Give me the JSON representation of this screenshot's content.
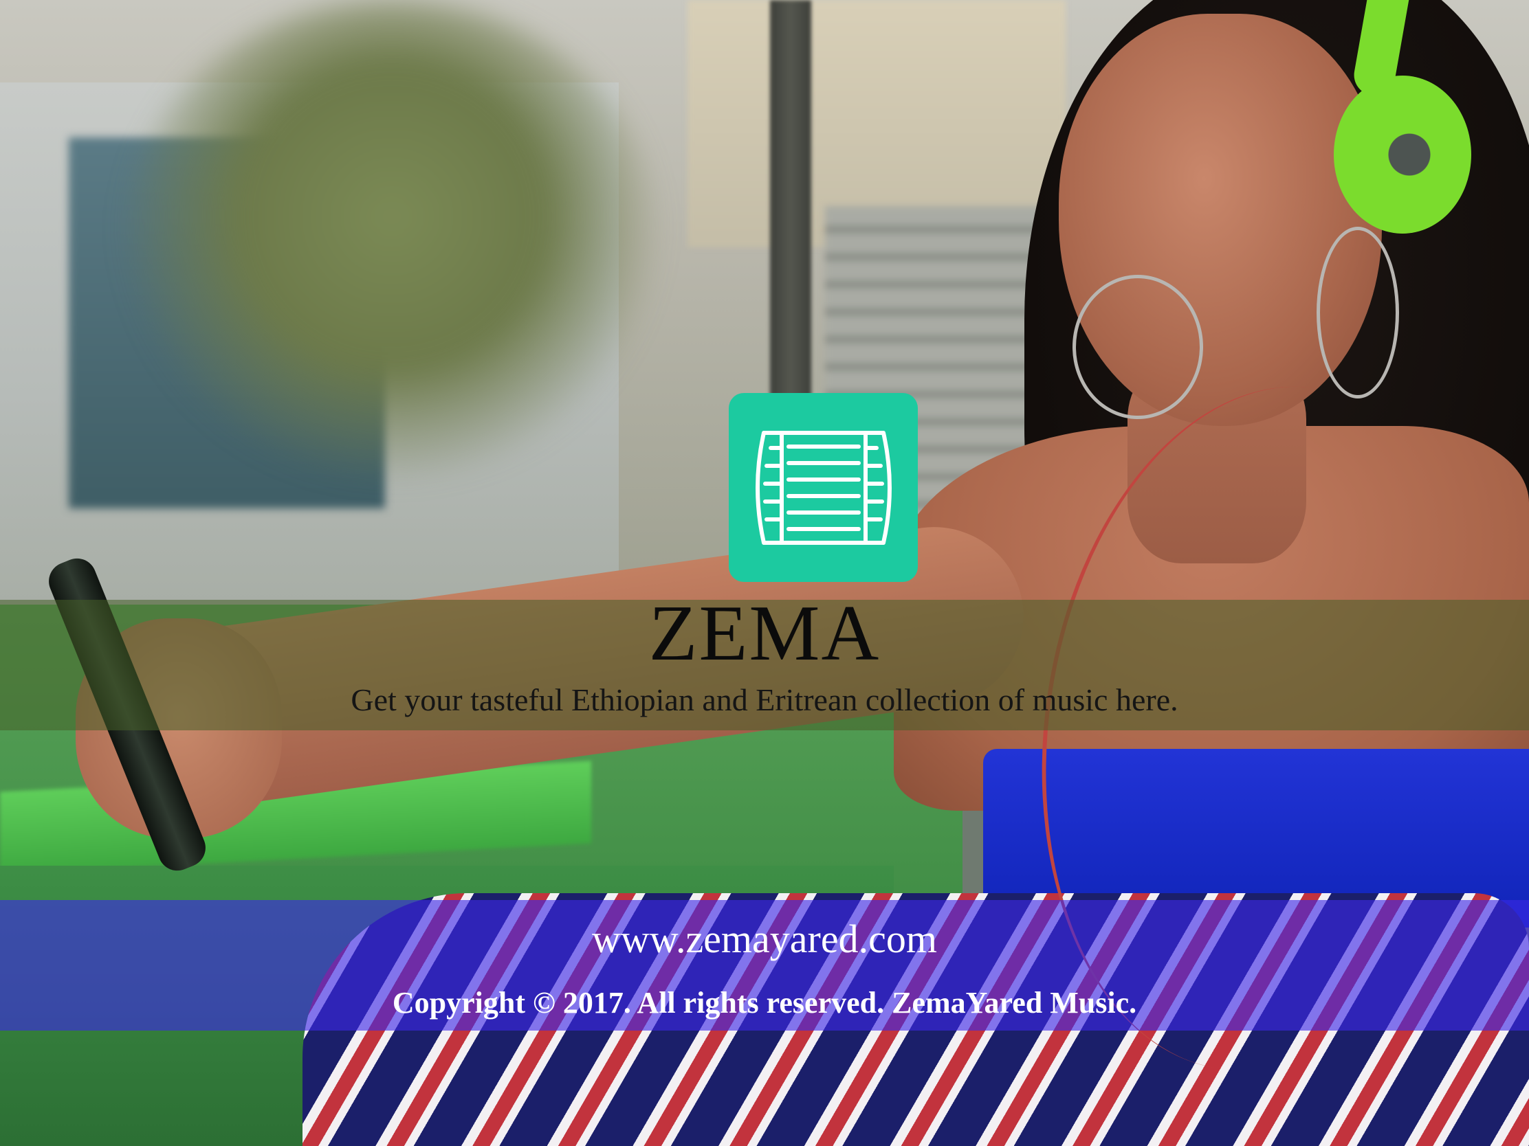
{
  "brand": {
    "name": "ZEMA",
    "tagline": "Get your tasteful Ethiopian and Eritrean collection of  music here.",
    "logo_icon": "kebero-drum-icon",
    "logo_color": "#1ccaa0"
  },
  "footer": {
    "url": "www.zemayared.com",
    "copyright": "Copyright © 2017. All rights reserved. ZemaYared Music."
  },
  "colors": {
    "green_band": "#465f28",
    "blue_band": "#3c28e6",
    "headphones": "#7bdc2d",
    "top": "#1024b8"
  }
}
